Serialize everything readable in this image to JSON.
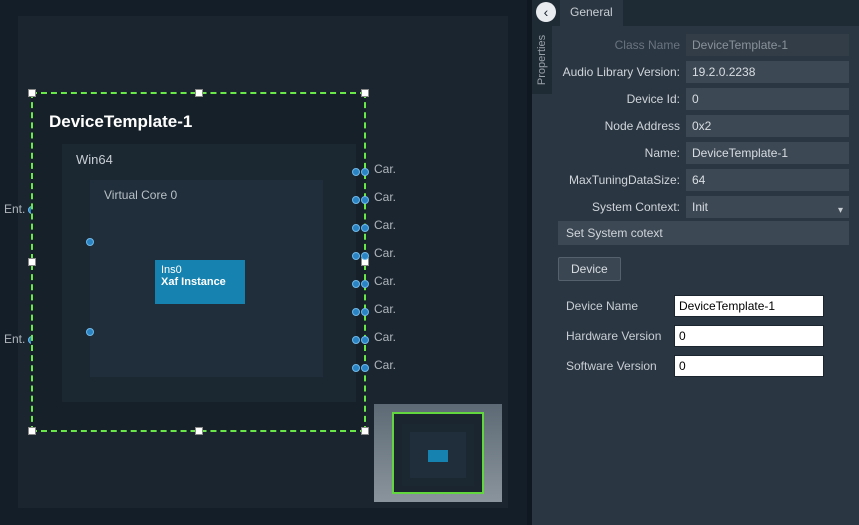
{
  "canvas": {
    "device_title": "DeviceTemplate-1",
    "platform": "Win64",
    "core": "Virtual Core 0",
    "instance_id": "Ins0",
    "instance_name": "Xaf Instance",
    "left_ports": [
      "Ent.",
      "Ent."
    ],
    "right_ports": [
      "Car.",
      "Car.",
      "Car.",
      "Car.",
      "Car.",
      "Car.",
      "Car.",
      "Car."
    ]
  },
  "tabs": {
    "general": "General",
    "side": "Properties"
  },
  "properties": {
    "class_name": {
      "label": "Class Name",
      "value": "DeviceTemplate-1"
    },
    "audio_lib": {
      "label": "Audio Library Version:",
      "value": "19.2.0.2238"
    },
    "device_id": {
      "label": "Device Id:",
      "value": "0"
    },
    "node_addr": {
      "label": "Node Address",
      "value": "0x2"
    },
    "name": {
      "label": "Name:",
      "value": "DeviceTemplate-1"
    },
    "max_tune": {
      "label": "MaxTuningDataSize:",
      "value": "64"
    },
    "sys_ctx": {
      "label": "System Context:",
      "value": "Init"
    },
    "set_ctx_btn": "Set System cotext",
    "device_btn": "Device",
    "device_name": {
      "label": "Device Name",
      "value": "DeviceTemplate-1"
    },
    "hw_ver": {
      "label": "Hardware Version",
      "value": "0"
    },
    "sw_ver": {
      "label": "Software Version",
      "value": "0"
    }
  }
}
